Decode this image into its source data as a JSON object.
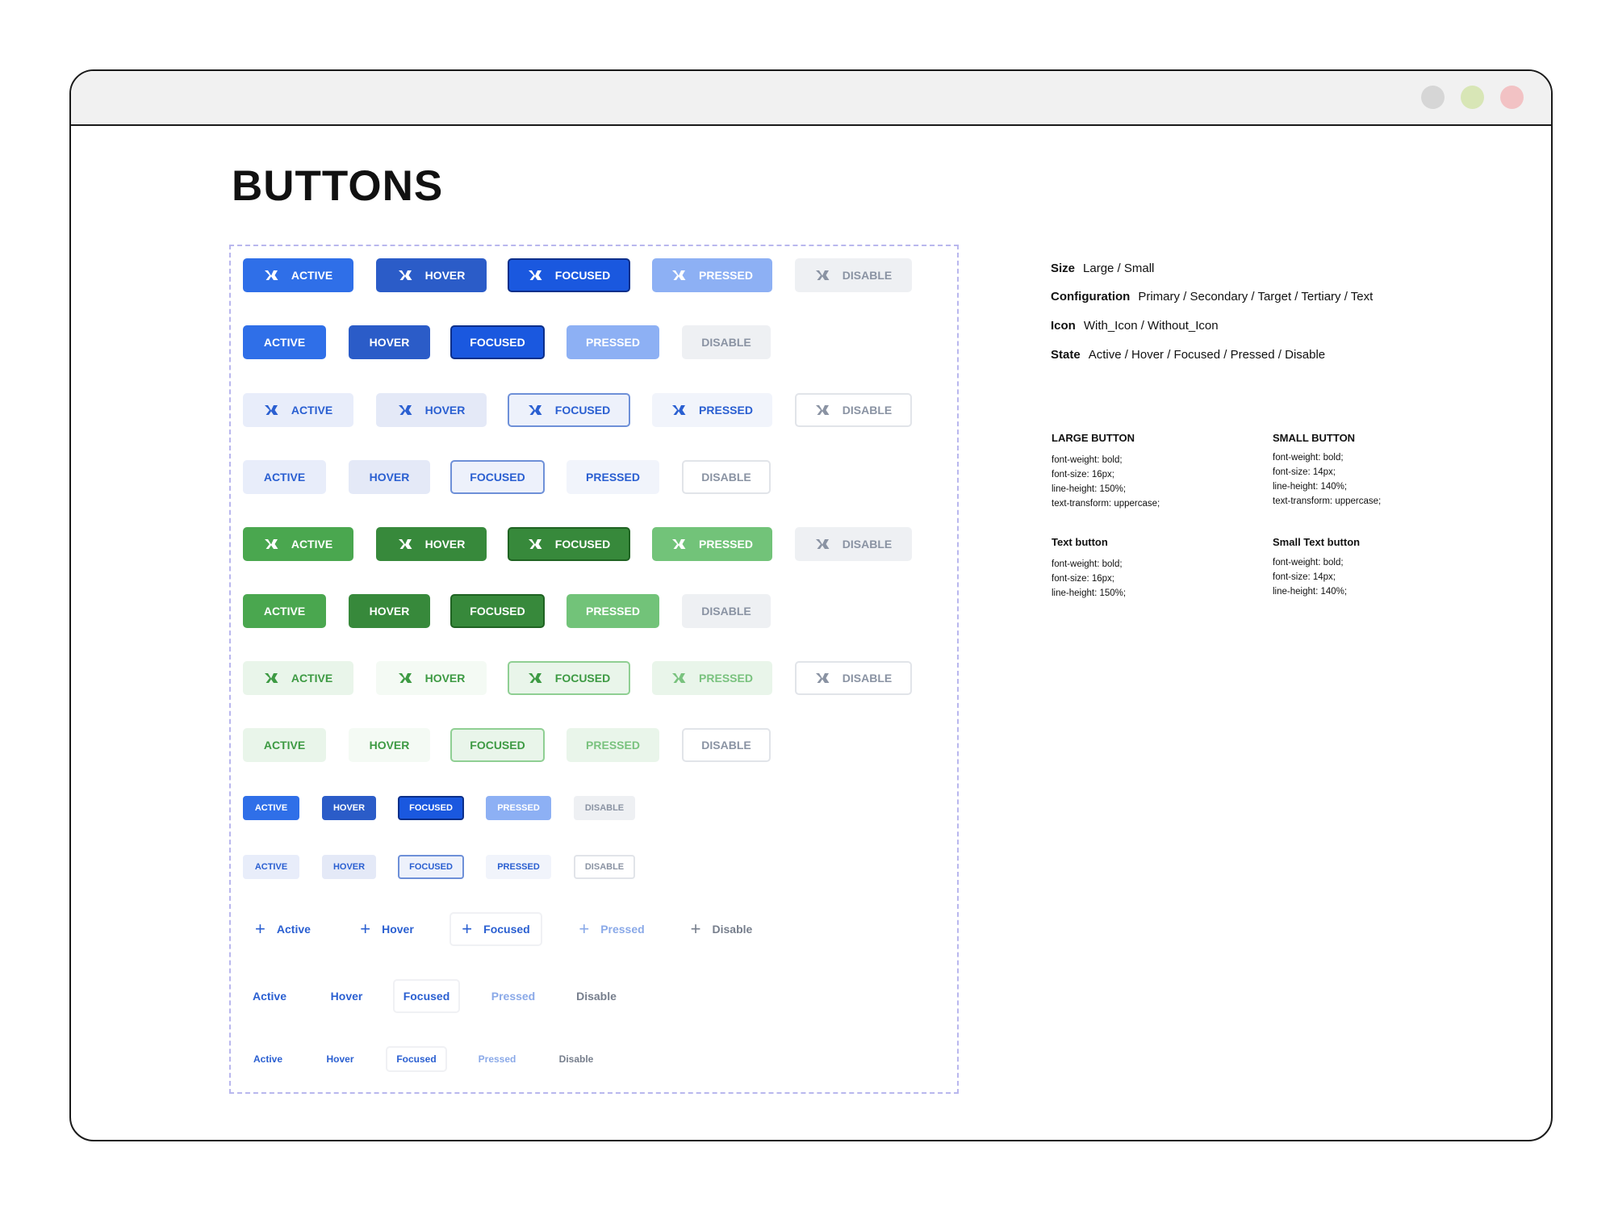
{
  "window": {
    "dots": [
      "#d6d6d6",
      "#d8e6b6",
      "#f2c2c4"
    ]
  },
  "page_title": "BUTTONS",
  "colors": {
    "blue": "#2f6fe8",
    "blue_hover": "#2b5cc8",
    "blue_focused": "#1a58df",
    "blue_pressed": "#8db0f4",
    "blue_light": "#e8edfa",
    "green": "#4aa74f",
    "green_hover": "#37893b",
    "green_pressed": "#72c379",
    "green_light": "#e9f5ea",
    "disable_bg": "#eef0f3",
    "disable_text": "#8a93a3",
    "text_blue": "#2a5fd1",
    "text_green": "#3d9a43"
  },
  "rows": [
    {
      "group": "primary-icon",
      "icon": "vk-icon",
      "labels": [
        "ACTIVE",
        "HOVER",
        "FOCUSED",
        "PRESSED",
        "DISABLE"
      ]
    },
    {
      "group": "primary",
      "labels": [
        "ACTIVE",
        "HOVER",
        "FOCUSED",
        "PRESSED",
        "DISABLE"
      ]
    },
    {
      "group": "secondary-icon",
      "icon": "vk-icon",
      "labels": [
        "ACTIVE",
        "HOVER",
        "FOCUSED",
        "PRESSED",
        "DISABLE"
      ]
    },
    {
      "group": "secondary",
      "labels": [
        "ACTIVE",
        "HOVER",
        "FOCUSED",
        "PRESSED",
        "DISABLE"
      ]
    },
    {
      "group": "target-icon",
      "icon": "vk-icon",
      "labels": [
        "ACTIVE",
        "HOVER",
        "FOCUSED",
        "PRESSED",
        "DISABLE"
      ]
    },
    {
      "group": "target",
      "labels": [
        "ACTIVE",
        "HOVER",
        "FOCUSED",
        "PRESSED",
        "DISABLE"
      ]
    },
    {
      "group": "tertiary-icon",
      "icon": "vk-icon",
      "labels": [
        "ACTIVE",
        "HOVER",
        "FOCUSED",
        "PRESSED",
        "DISABLE"
      ]
    },
    {
      "group": "tertiary",
      "labels": [
        "ACTIVE",
        "HOVER",
        "FOCUSED",
        "PRESSED",
        "DISABLE"
      ]
    },
    {
      "group": "small-primary",
      "labels": [
        "ACTIVE",
        "HOVER",
        "FOCUSED",
        "PRESSED",
        "DISABLE"
      ]
    },
    {
      "group": "small-secondary",
      "labels": [
        "ACTIVE",
        "HOVER",
        "FOCUSED",
        "PRESSED",
        "DISABLE"
      ]
    },
    {
      "group": "text-icon",
      "icon": "plus-icon",
      "labels": [
        "Active",
        "Hover",
        "Focused",
        "Pressed",
        "Disable"
      ]
    },
    {
      "group": "text",
      "labels": [
        "Active",
        "Hover",
        "Focused",
        "Pressed",
        "Disable"
      ]
    },
    {
      "group": "small-text",
      "labels": [
        "Active",
        "Hover",
        "Focused",
        "Pressed",
        "Disable"
      ]
    }
  ],
  "spec": [
    {
      "key": "Size",
      "value": "Large / Small"
    },
    {
      "key": "Configuration",
      "value": "Primary / Secondary / Target / Tertiary / Text"
    },
    {
      "key": "Icon",
      "value": "With_Icon / Without_Icon"
    },
    {
      "key": "State",
      "value": "Active / Hover / Focused / Pressed / Disable"
    }
  ],
  "typography": [
    {
      "title": "LARGE BUTTON",
      "lines": [
        "font-weight: bold;",
        "font-size: 16px;",
        "line-height: 150%;",
        "text-transform: uppercase;"
      ]
    },
    {
      "title": "SMALL BUTTON",
      "lines": [
        "font-weight: bold;",
        "font-size: 14px;",
        "line-height: 140%;",
        "text-transform: uppercase;"
      ]
    },
    {
      "title": "Text button",
      "lines": [
        "font-weight: bold;",
        "font-size: 16px;",
        "line-height: 150%;"
      ]
    },
    {
      "title": "Small Text button",
      "lines": [
        "font-weight: bold;",
        "font-size: 14px;",
        "line-height: 140%;"
      ]
    }
  ]
}
